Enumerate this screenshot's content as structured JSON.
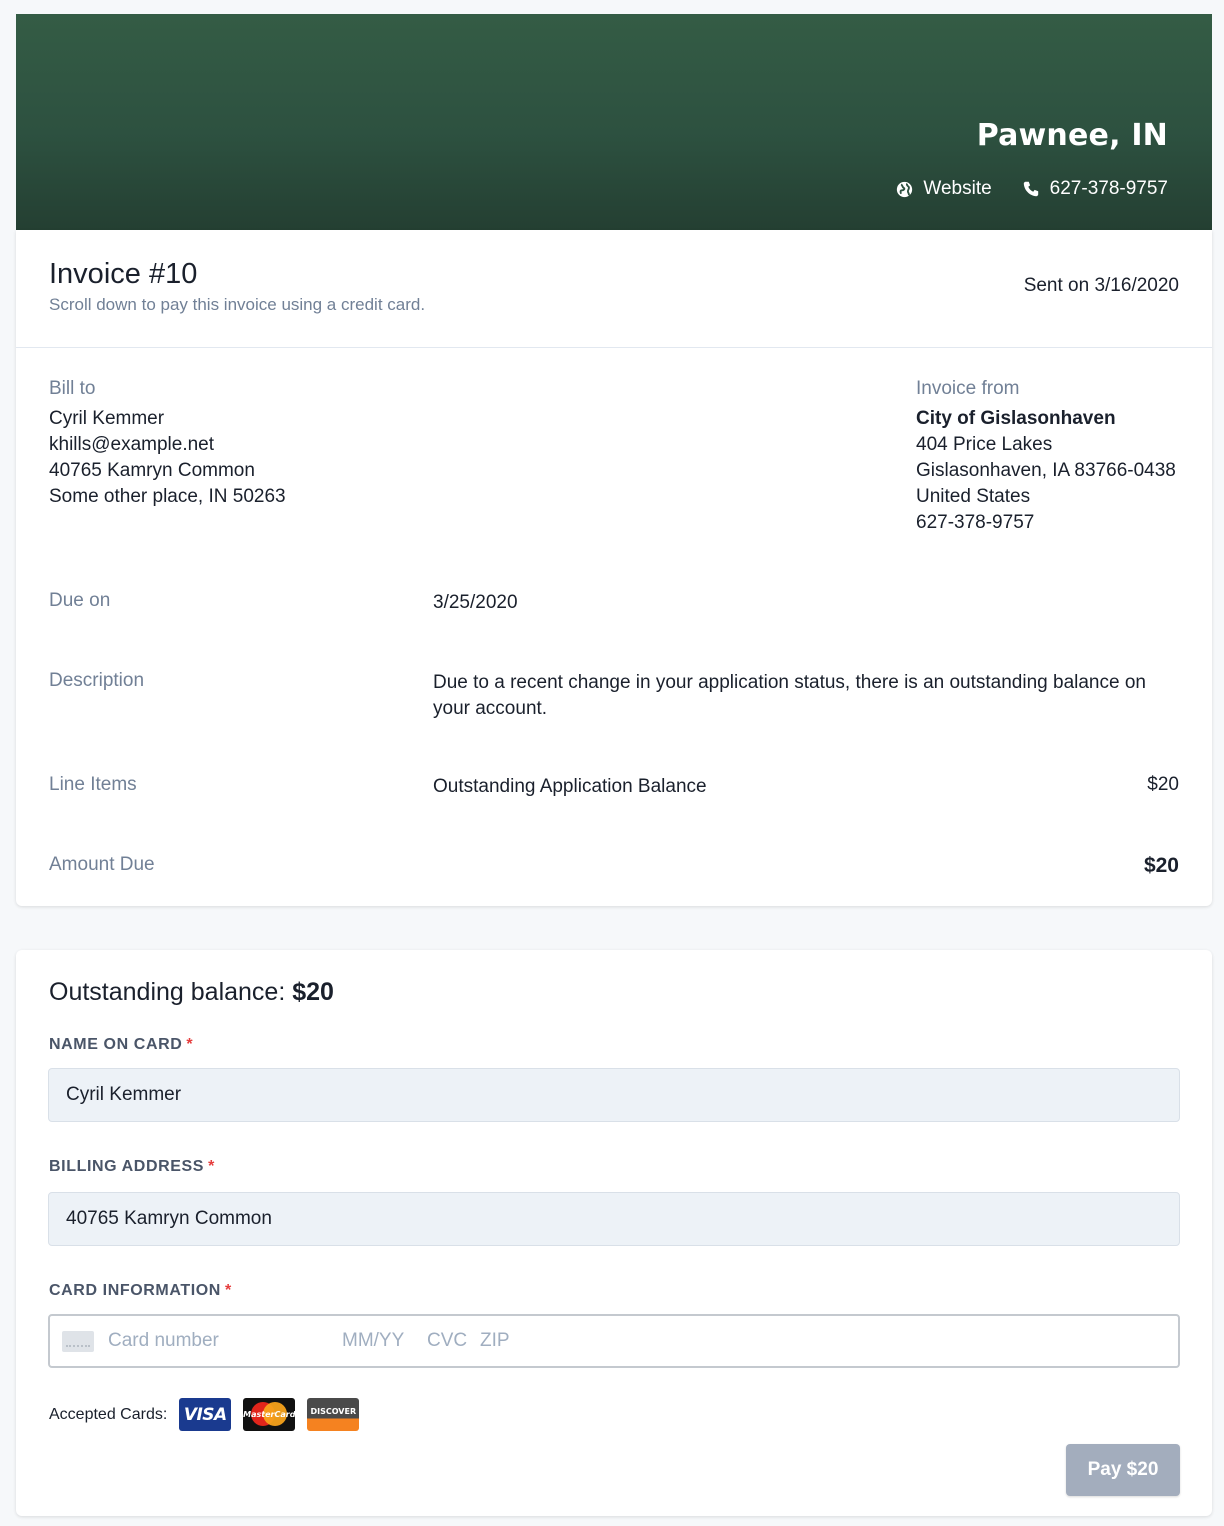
{
  "header": {
    "title": "Pawnee, IN",
    "website_label": "Website",
    "phone": "627-378-9757",
    "bg_color": "#2d5140"
  },
  "invoice": {
    "title": "Invoice #10",
    "subtitle": "Scroll down to pay this invoice using a credit card.",
    "sent": "Sent on 3/16/2020",
    "bill_to": {
      "label": "Bill to",
      "name": "Cyril Kemmer",
      "email": "khills@example.net",
      "address1": "40765 Kamryn Common",
      "address2": "Some other place, IN 50263"
    },
    "from": {
      "label": "Invoice from",
      "name": "City of Gislasonhaven",
      "address1": "404 Price Lakes",
      "address2": "Gislasonhaven, IA 83766-0438",
      "country": "United States",
      "phone": "627-378-9757"
    },
    "due_label": "Due on",
    "due_value": "3/25/2020",
    "description_label": "Description",
    "description_value": "Due to a recent change in your application status, there is an outstanding balance on your account.",
    "line_items_label": "Line Items",
    "line_items": [
      {
        "name": "Outstanding Application Balance",
        "amount": "$20"
      }
    ],
    "amount_due_label": "Amount Due",
    "amount_due_value": "$20"
  },
  "payment": {
    "balance_label": "Outstanding balance:",
    "balance_value": "$20",
    "name_label": "NAME ON CARD",
    "name_value": "Cyril Kemmer",
    "address_label": "BILLING ADDRESS",
    "address_value": "40765 Kamryn Common",
    "card_label": "CARD INFORMATION",
    "required_mark": "*",
    "card_placeholders": {
      "number": "Card number",
      "expiry": "MM/YY",
      "cvc": "CVC",
      "zip": "ZIP"
    },
    "accepted_label": "Accepted Cards:",
    "brands": {
      "visa": "VISA",
      "mastercard": "MasterCard",
      "discover": "DISCOVER"
    },
    "pay_button": "Pay $20",
    "pay_button_color": "#a3adbd"
  }
}
